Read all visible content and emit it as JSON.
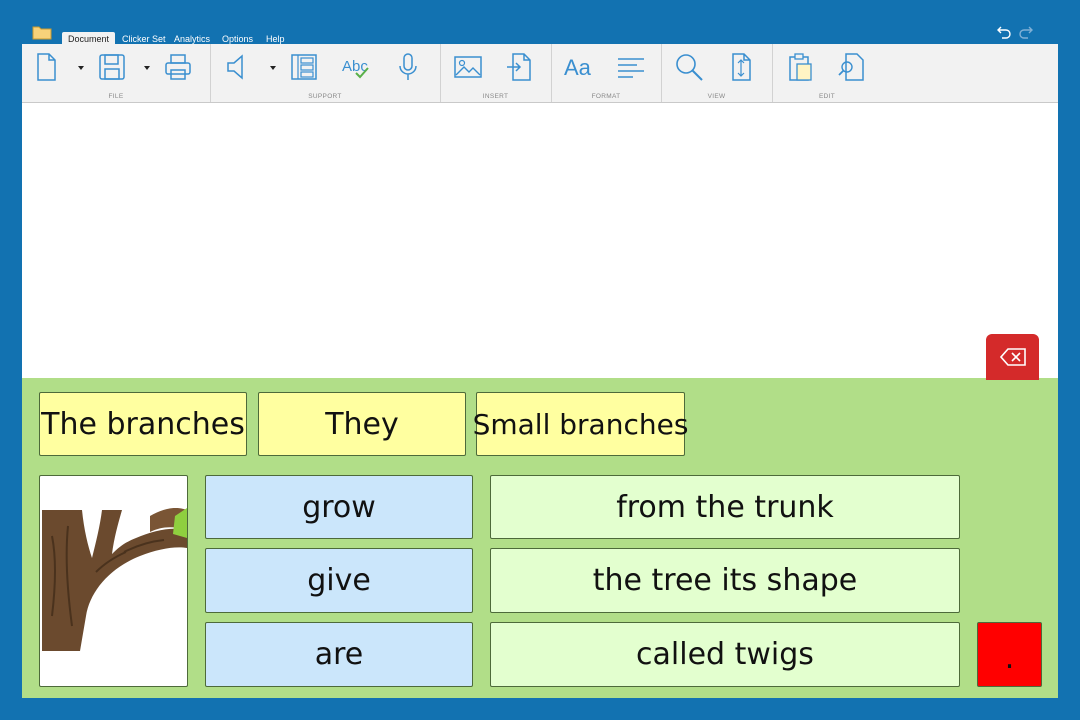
{
  "tabs": [
    "Document",
    "Clicker Set",
    "Analytics",
    "Options",
    "Help"
  ],
  "ribbon_groups": [
    "FILE",
    "SUPPORT",
    "INSERT",
    "FORMAT",
    "VIEW",
    "EDIT"
  ],
  "format_button_text": "Aa",
  "spell_button_text": "Abc",
  "grid": {
    "sentence_starters": [
      "The branches",
      "They",
      "Small branches"
    ],
    "verbs": [
      "grow",
      "give",
      "are"
    ],
    "endings": [
      "from the trunk",
      "the tree its shape",
      "called twigs"
    ],
    "punctuation": "."
  },
  "colors": {
    "frame": "#1272b1",
    "grid_bg": "#b1de88",
    "starter": "#ffffa0",
    "verb": "#cbe6fb",
    "ending": "#e3ffcf",
    "backspace": "#d42a2a",
    "punct": "#ff0000"
  }
}
